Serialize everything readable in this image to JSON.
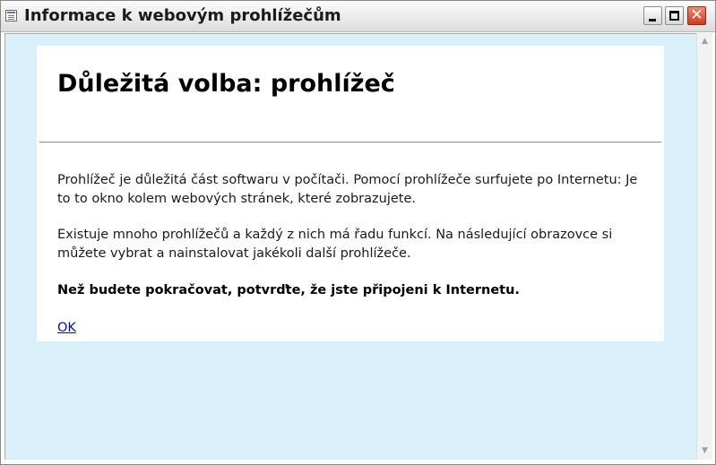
{
  "window": {
    "title": "Informace k webovým prohlížečům",
    "icon": "window-app-icon",
    "controls": {
      "minimize": "minimize-icon",
      "maximize": "maximize-icon",
      "close_glyph": "✕"
    }
  },
  "content": {
    "heading": "Důležitá volba: prohlížeč",
    "paragraphs": [
      "Prohlížeč je důležitá část softwaru v počítači. Pomocí prohlížeče surfujete po Internetu: Je to to okno kolem webových stránek, které zobrazujete.",
      "Existuje mnoho prohlížečů a každý z nich má řadu funkcí. Na následující obrazovce si můžete vybrat a nainstalovat jakékoli další prohlížeče.",
      "Než budete pokračovat, potvrďte, že jste připojeni k Internetu."
    ],
    "ok_link": "OK"
  },
  "scrollbar": {
    "up_glyph": "▲",
    "down_glyph": "▼"
  },
  "colors": {
    "client_background": "#d9f0fb",
    "panel_background": "#ffffff",
    "link": "#0a0aa8",
    "close_button": "#cc3b1e"
  }
}
